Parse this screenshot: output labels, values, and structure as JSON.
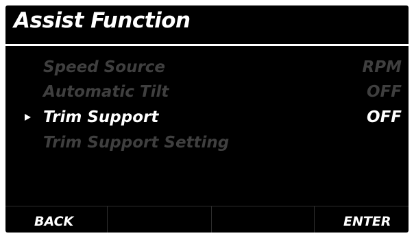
{
  "screen": {
    "title": "Assist Function",
    "colors": {
      "background": "#000000",
      "text": "#ffffff",
      "disabled_text": "#3f3f3f",
      "divider": "#2f2f2f"
    }
  },
  "menu": {
    "selected_index": 2,
    "items": [
      {
        "label": "Speed Source",
        "value": "RPM",
        "state": "disabled"
      },
      {
        "label": "Automatic Tilt",
        "value": "OFF",
        "state": "disabled"
      },
      {
        "label": "Trim Support",
        "value": "OFF",
        "state": "selected"
      },
      {
        "label": "Trim Support Setting",
        "value": "",
        "state": "disabled"
      }
    ],
    "cursor_icon": "triangle-right-icon"
  },
  "softkeys": [
    {
      "label": "BACK"
    },
    {
      "label": ""
    },
    {
      "label": ""
    },
    {
      "label": "ENTER"
    }
  ]
}
